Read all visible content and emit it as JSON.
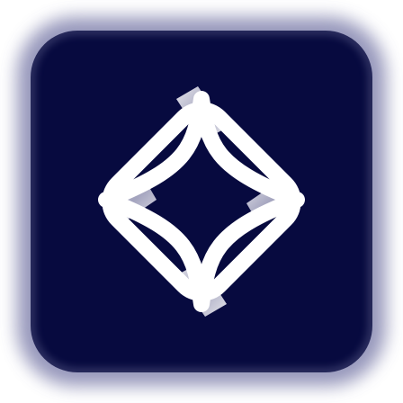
{
  "app_icon": {
    "icon": "sparkle-diamond-logo-icon",
    "colors": {
      "background": "#070a3f",
      "glow": "#8e8fb6",
      "stroke": "#ffffff",
      "shade": "#a9a9c4"
    }
  }
}
